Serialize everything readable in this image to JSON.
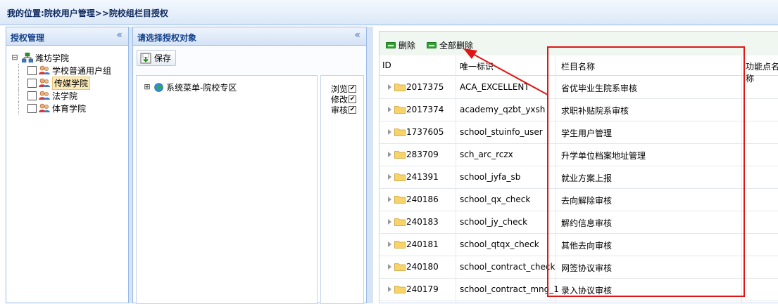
{
  "breadcrumb": "我的位置:院校用户管理>>院校组栏目授权",
  "left_panel": {
    "title": "授权管理",
    "collapse_glyph": "«",
    "root": {
      "label": "潍坊学院",
      "expander": "⊟"
    },
    "groups": [
      {
        "label": "学校普通用户组",
        "selected": false
      },
      {
        "label": "传媒学院",
        "selected": true
      },
      {
        "label": "法学院",
        "selected": false
      },
      {
        "label": "体育学院",
        "selected": false
      }
    ]
  },
  "middle_panel": {
    "title": "请选择授权对象",
    "collapse_glyph": "«",
    "save_label": "保存",
    "menu_tree": {
      "expander": "⊞",
      "label": "系统菜单-院校专区"
    },
    "permissions": [
      {
        "label": "浏览",
        "checked": true
      },
      {
        "label": "修改",
        "checked": true
      },
      {
        "label": "审核",
        "checked": true
      }
    ]
  },
  "right_panel": {
    "toolbar": {
      "delete_label": "删除",
      "delete_all_label": "全部删除"
    },
    "columns": [
      "ID",
      "唯一标识",
      "栏目名称",
      "功能点名称"
    ],
    "rows": [
      {
        "id": "2017375",
        "key": "ACA_EXCELLENT",
        "name": "省优毕业生院系审核"
      },
      {
        "id": "2017374",
        "key": "academy_qzbt_yxsh",
        "name": "求职补贴院系审核"
      },
      {
        "id": "1737605",
        "key": "school_stuinfo_user",
        "name": "学生用户管理"
      },
      {
        "id": "283709",
        "key": "sch_arc_rczx",
        "name": "升学单位档案地址管理"
      },
      {
        "id": "241391",
        "key": "school_jyfa_sb",
        "name": "就业方案上报"
      },
      {
        "id": "240186",
        "key": "school_qx_check",
        "name": "去向解除审核"
      },
      {
        "id": "240183",
        "key": "school_jy_check",
        "name": "解约信息审核"
      },
      {
        "id": "240181",
        "key": "school_qtqx_check",
        "name": "其他去向审核"
      },
      {
        "id": "240180",
        "key": "school_contract_check",
        "name": "网签协议审核"
      },
      {
        "id": "240179",
        "key": "school_contract_mng_1",
        "name": "录入协议审核"
      }
    ]
  },
  "colors": {
    "accent": "#15428b",
    "panel_border": "#99bbe8",
    "annotation": "#e01616"
  }
}
